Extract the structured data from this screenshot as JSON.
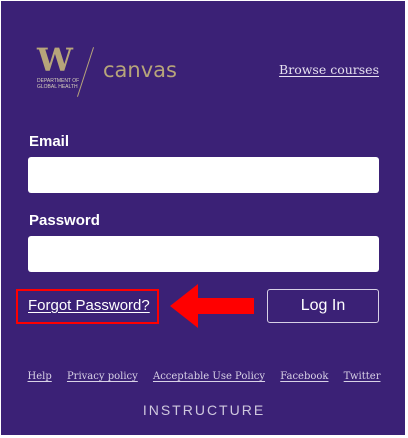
{
  "logo": {
    "letter": "W",
    "department": "DEPARTMENT of GLOBAL HEALTH",
    "product": "canvas"
  },
  "header": {
    "browse_courses": "Browse courses"
  },
  "form": {
    "email_label": "Email",
    "email_value": "",
    "password_label": "Password",
    "password_value": "",
    "forgot_password": "Forgot Password?",
    "login_button": "Log In"
  },
  "footer": {
    "links": [
      "Help",
      "Privacy policy",
      "Acceptable Use Policy",
      "Facebook",
      "Twitter"
    ],
    "brand": "INSTRUCTURE"
  },
  "colors": {
    "background": "#3b2176",
    "gold": "#b7a57a",
    "highlight": "#ff0000"
  }
}
